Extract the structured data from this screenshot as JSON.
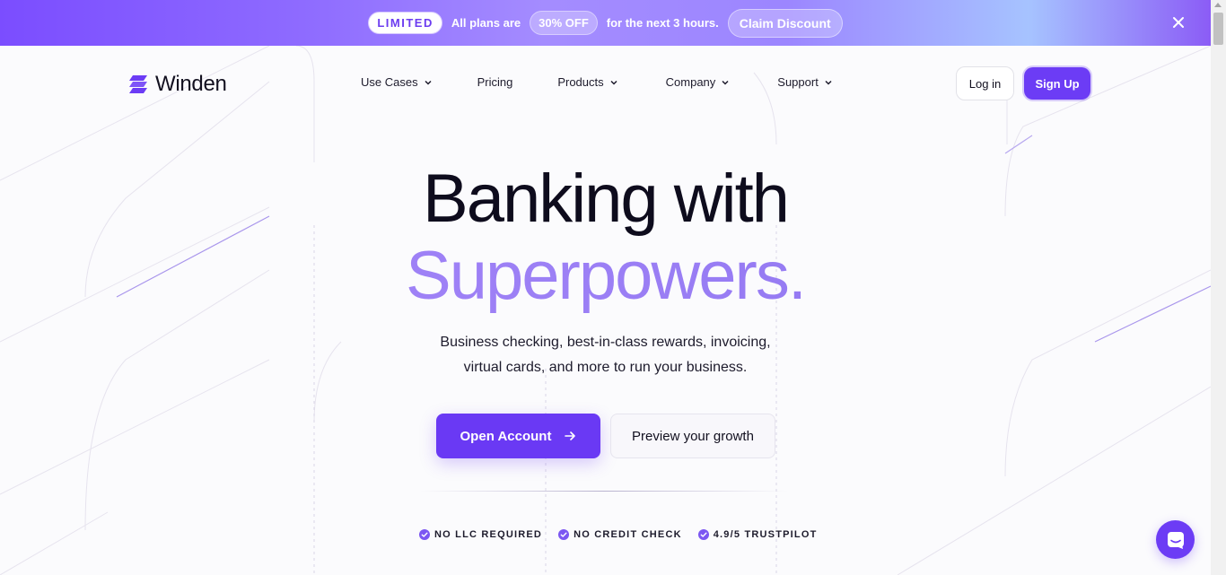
{
  "promo": {
    "limited": "LIMITED",
    "text_before": "All plans are",
    "discount": "30% OFF",
    "text_after": "for the next 3 hours.",
    "claim": "Claim Discount"
  },
  "nav": {
    "brand": "Winden",
    "links": [
      {
        "label": "Use Cases",
        "dropdown": true
      },
      {
        "label": "Pricing",
        "dropdown": false
      },
      {
        "label": "Products",
        "dropdown": true
      },
      {
        "label": "Company",
        "dropdown": true
      },
      {
        "label": "Support",
        "dropdown": true
      }
    ],
    "login": "Log in",
    "signup": "Sign Up"
  },
  "hero": {
    "line1": "Banking with",
    "line2": "Superpowers.",
    "sub1": "Business checking, best-in-class rewards, invoicing,",
    "sub2": "virtual cards, and more to run your business.",
    "cta_primary": "Open Account",
    "cta_secondary": "Preview your growth"
  },
  "badges": [
    "NO LLC REQUIRED",
    "NO CREDIT CHECK",
    "4.9/5 TRUSTPILOT"
  ],
  "colors": {
    "accent": "#6c3cf5",
    "hero_gradient": "#9a7ef5",
    "text": "#12101f"
  },
  "icons": {
    "logo": "winden-logo-icon",
    "close": "close-icon",
    "chevron": "chevron-down-icon",
    "arrow": "arrow-right-icon",
    "check": "check-circle-icon",
    "chat": "chat-icon"
  }
}
